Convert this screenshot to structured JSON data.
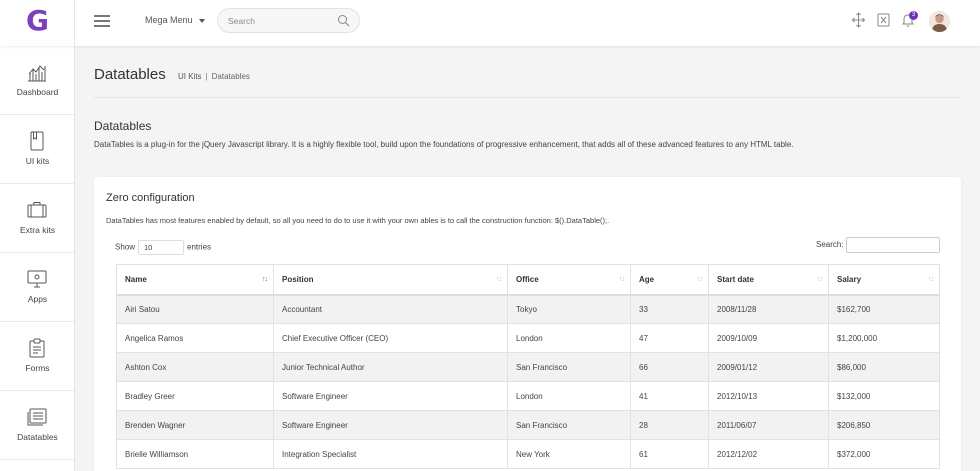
{
  "header": {
    "logo": "G",
    "mega_menu": "Mega Menu",
    "search_placeholder": "Search",
    "notification_count": "3"
  },
  "sidebar": {
    "items": [
      {
        "label": "Dashboard",
        "icon": "chart-bars-icon"
      },
      {
        "label": "UI kits",
        "icon": "book-icon"
      },
      {
        "label": "Extra kits",
        "icon": "briefcase-icon"
      },
      {
        "label": "Apps",
        "icon": "monitor-icon"
      },
      {
        "label": "Forms",
        "icon": "clipboard-icon"
      },
      {
        "label": "Datatables",
        "icon": "table-icon"
      }
    ]
  },
  "page": {
    "title": "Datatables",
    "breadcrumb": [
      "UI Kits",
      "Datatables"
    ]
  },
  "section": {
    "title": "Datatables",
    "description": "DataTables is a plug-in for the jQuery Javascript library. It is a highly flexible tool, build upon the foundations of progressive enhancement, that adds all of these advanced features to any HTML table."
  },
  "card": {
    "title": "Zero configuration",
    "description": "DataTables has most features enabled by default, so all you need to do to use it with your own ables is to call the construction function: $().DataTable();.",
    "show_label": "Show",
    "entries_value": "10",
    "entries_label": "entries",
    "search_label": "Search:"
  },
  "table": {
    "columns": [
      "Name",
      "Position",
      "Office",
      "Age",
      "Start date",
      "Salary"
    ],
    "rows": [
      [
        "Airi Satou",
        "Accountant",
        "Tokyo",
        "33",
        "2008/11/28",
        "$162,700"
      ],
      [
        "Angelica Ramos",
        "Chief Executive Officer (CEO)",
        "London",
        "47",
        "2009/10/09",
        "$1,200,000"
      ],
      [
        "Ashton Cox",
        "Junior Technical Author",
        "San Francisco",
        "66",
        "2009/01/12",
        "$86,000"
      ],
      [
        "Bradley Greer",
        "Software Engineer",
        "London",
        "41",
        "2012/10/13",
        "$132,000"
      ],
      [
        "Brenden Wagner",
        "Software Engineer",
        "San Francisco",
        "28",
        "2011/06/07",
        "$206,850"
      ],
      [
        "Brielle Williamson",
        "Integration Specialist",
        "New York",
        "61",
        "2012/12/02",
        "$372,000"
      ]
    ]
  },
  "colors": {
    "brand": "#7b3fbf",
    "badge": "#6f2fb8",
    "row_stripe": "#f2f2f2"
  }
}
